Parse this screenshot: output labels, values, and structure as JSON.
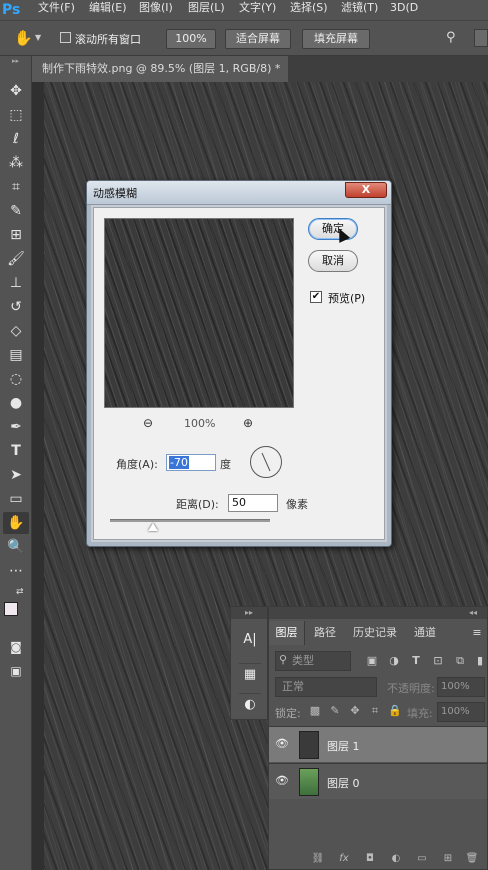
{
  "app": {
    "logo": "Ps"
  },
  "menu": [
    "文件(F)",
    "编辑(E)",
    "图像(I)",
    "图层(L)",
    "文字(Y)",
    "选择(S)",
    "滤镜(T)",
    "3D(D"
  ],
  "options": {
    "scroll_all_label": "滚动所有窗口",
    "zoom_value": "100%",
    "fit_screen": "适合屏幕",
    "fill_screen": "填充屏幕"
  },
  "document": {
    "tab_title": "制作下雨特效.png @ 89.5% (图层 1, RGB/8) *",
    "close": "×"
  },
  "dialog": {
    "title": "动感模糊",
    "close": "X",
    "ok": "确定",
    "cancel": "取消",
    "preview_label": "预览(P)",
    "preview_checked": true,
    "zoom": "100%",
    "angle_label": "角度(A):",
    "angle_value": "-70",
    "angle_unit": "度",
    "distance_label": "距离(D):",
    "distance_value": "50",
    "distance_unit": "像素"
  },
  "layers_panel": {
    "tabs": [
      "图层",
      "路径",
      "历史记录",
      "通道"
    ],
    "filter": "类型",
    "blend": "正常",
    "opacity_label": "不透明度:",
    "opacity": "100%",
    "lock_label": "锁定:",
    "fill_label": "填充:",
    "fill": "100%",
    "layers": [
      {
        "name": "图层 1",
        "selected": true
      },
      {
        "name": "图层 0",
        "selected": false
      }
    ],
    "bottom_icons": [
      "link-icon",
      "fx-icon",
      "mask-icon",
      "adjustment-icon",
      "group-icon",
      "new-layer-icon",
      "trash-icon"
    ]
  },
  "tools": [
    "move-icon",
    "marquee-icon",
    "lasso-icon",
    "magic-wand-icon",
    "crop-icon",
    "eyedropper-icon",
    "healing-icon",
    "brush-icon",
    "stamp-icon",
    "history-brush-icon",
    "eraser-icon",
    "gradient-icon",
    "blur-icon",
    "dodge-icon",
    "pen-icon",
    "type-icon",
    "path-select-icon",
    "shape-icon",
    "hand-icon",
    "zoom-icon",
    "more-icon"
  ]
}
